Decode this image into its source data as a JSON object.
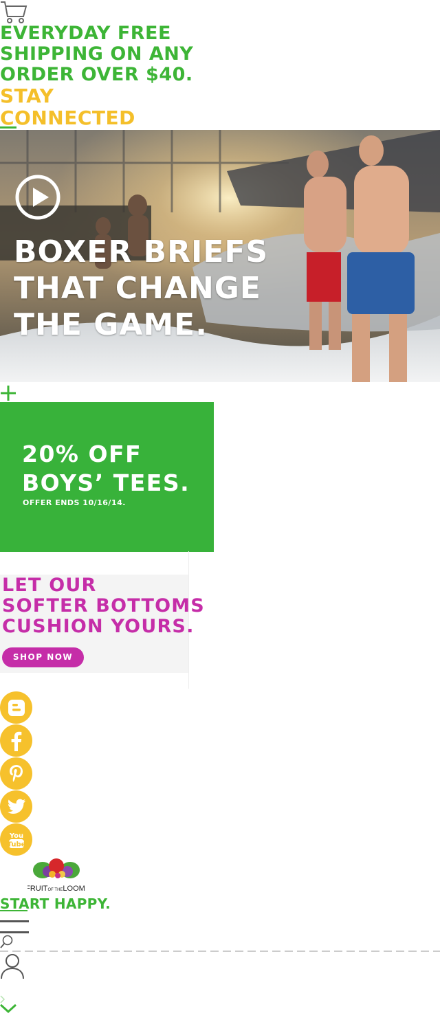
{
  "header": {
    "cart_icon": "cart-icon",
    "promo_text": "EVERYDAY FREE SHIPPING ON ANY ORDER OVER $40.",
    "stay_connected": "STAY CONNECTED"
  },
  "hero": {
    "headline": "BOXER BRIEFS\nTHAT CHANGE\nTHE GAME.",
    "play_icon": "play-icon"
  },
  "expand_icon": "plus-icon",
  "tees_promo": {
    "headline": "20% OFF\nBOYS’ TEES.",
    "subtext": "OFFER ENDS 10/16/14."
  },
  "bottoms_promo": {
    "headline": "LET OUR\nSOFTER BOTTOMS\nCUSHION YOURS.",
    "button_label": "SHOP NOW"
  },
  "social": [
    {
      "icon": "blogger-icon"
    },
    {
      "icon": "facebook-icon"
    },
    {
      "icon": "pinterest-icon"
    },
    {
      "icon": "twitter-icon"
    },
    {
      "icon": "youtube-icon",
      "label": "You Tube"
    }
  ],
  "brand": {
    "logo_text": "FRUIT OF THE LOOM.",
    "tagline": "START HAPPY."
  },
  "nav_icons": [
    "menu-icon",
    "search-icon",
    "user-icon",
    "chevron-down-icon"
  ],
  "colors": {
    "green": "#3db536",
    "yellow": "#f4bf2a",
    "magenta": "#c52da8",
    "tees_bg": "#38b23a"
  }
}
